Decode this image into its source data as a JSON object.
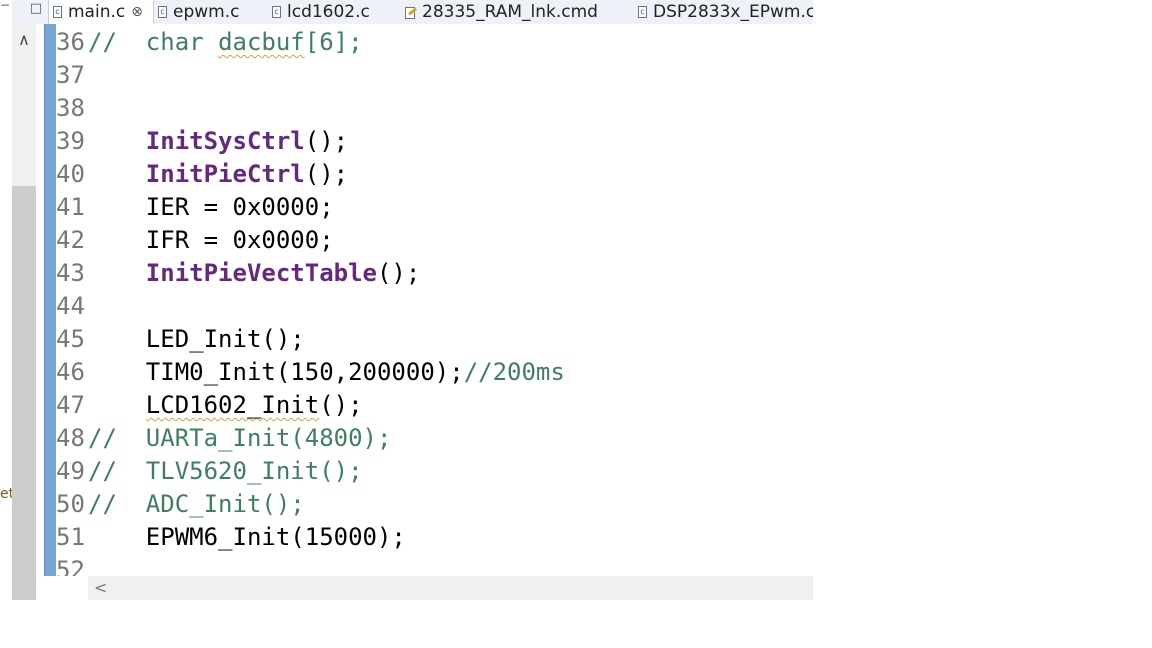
{
  "tabs": [
    {
      "label": "main.c",
      "active": true,
      "closable": true,
      "icon": "c-file-icon"
    },
    {
      "label": "epwm.c",
      "active": false,
      "icon": "c-file-icon"
    },
    {
      "label": "lcd1602.c",
      "active": false,
      "icon": "c-file-icon"
    },
    {
      "label": "28335_RAM_lnk.cmd",
      "active": false,
      "icon": "cmd-file-icon"
    },
    {
      "label": "DSP2833x_EPwm.c",
      "active": false,
      "icon": "c-file-icon"
    }
  ],
  "left_fragment": "et",
  "code": {
    "l36": {
      "n": "36",
      "c": "//",
      "t": "  char dacbuf[6];"
    },
    "l37": {
      "n": "37"
    },
    "l38": {
      "n": "38"
    },
    "l39": {
      "n": "39",
      "fn": "InitSysCtrl",
      "t": "();"
    },
    "l40": {
      "n": "40",
      "fn": "InitPieCtrl",
      "t": "();"
    },
    "l41": {
      "n": "41",
      "t": "IER = 0x0000;"
    },
    "l42": {
      "n": "42",
      "t": "IFR = 0x0000;"
    },
    "l43": {
      "n": "43",
      "fn": "InitPieVectTable",
      "t": "();"
    },
    "l44": {
      "n": "44"
    },
    "l45": {
      "n": "45",
      "t": "LED_Init();"
    },
    "l46": {
      "n": "46",
      "t": "TIM0_Init(150,200000);",
      "c": "//200ms"
    },
    "l47": {
      "n": "47",
      "t1": "LCD1602_Init",
      "t2": "();"
    },
    "l48": {
      "n": "48",
      "c": "//  UARTa_Init(4800);"
    },
    "l49": {
      "n": "49",
      "c": "//  TLV5620_Init();"
    },
    "l50": {
      "n": "50",
      "c": "//  ADC_Init();"
    },
    "l51": {
      "n": "51",
      "t": "EPWM6_Init(15000);"
    },
    "l52": {
      "n": "52"
    }
  }
}
